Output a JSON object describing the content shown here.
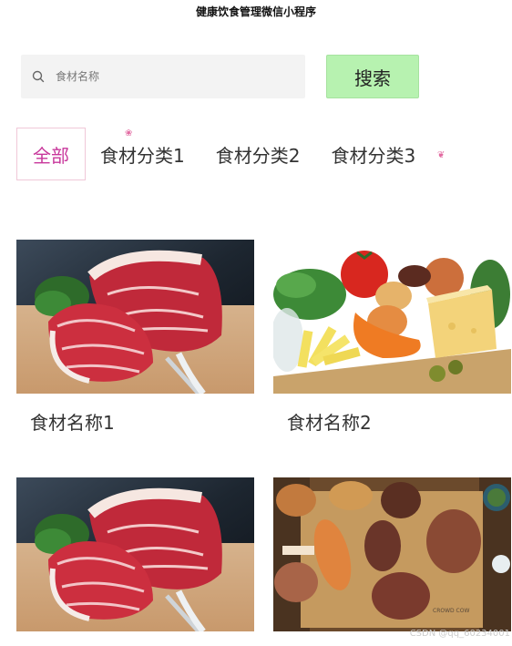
{
  "app": {
    "title": "健康饮食管理微信小程序"
  },
  "search": {
    "placeholder": "食材名称",
    "button_label": "搜索"
  },
  "tabs": [
    {
      "label": "全部",
      "active": true
    },
    {
      "label": "食材分类1",
      "active": false
    },
    {
      "label": "食材分类2",
      "active": false
    },
    {
      "label": "食材分类3",
      "active": false
    }
  ],
  "items": [
    {
      "name": "食材名称1",
      "image": "marbled-beef-photo"
    },
    {
      "name": "食材名称2",
      "image": "vegetables-cheese-photo"
    },
    {
      "name": "",
      "image": "marbled-beef-photo"
    },
    {
      "name": "",
      "image": "grilled-meats-photo"
    }
  ],
  "watermark": "CSDN @qq_60234001",
  "colors": {
    "search_button_bg": "#b7f2b0",
    "active_tab_text": "#c8379b",
    "active_tab_border": "#f0c8d8"
  }
}
